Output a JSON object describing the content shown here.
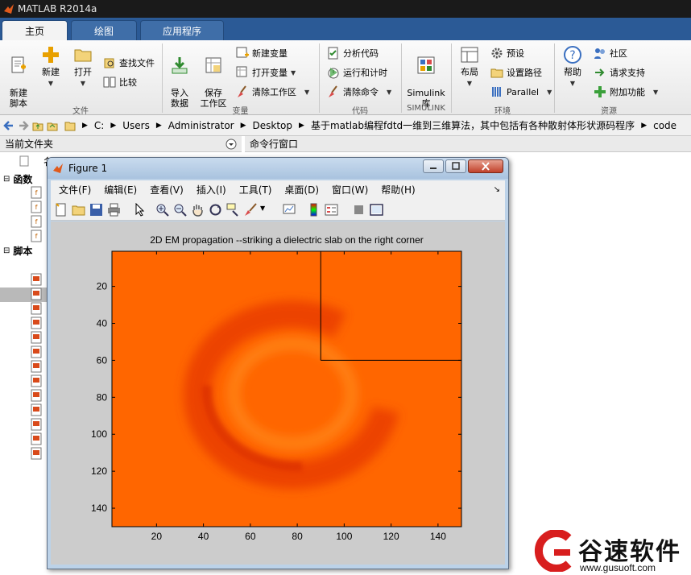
{
  "app": {
    "title": "MATLAB R2014a"
  },
  "tabs": [
    {
      "label": "主页"
    },
    {
      "label": "绘图"
    },
    {
      "label": "应用程序"
    }
  ],
  "ribbon": {
    "new_script": "新建\n脚本",
    "new": "新建",
    "open": "打开",
    "find_files": "查找文件",
    "compare": "比较",
    "import": "导入\n数据",
    "save_ws": "保存\n工作区",
    "new_var": "新建变量",
    "open_var": "打开变量",
    "clear_ws": "清除工作区",
    "analyze": "分析代码",
    "run_time": "运行和计时",
    "clear_cmd": "清除命令",
    "simulink": "Simulink\n库",
    "layout": "布局",
    "prefs": "预设",
    "set_path": "设置路径",
    "parallel": "Parallel",
    "help": "帮助",
    "community": "社区",
    "support": "请求支持",
    "addons": "附加功能",
    "groups": {
      "file": "文件",
      "variable": "变量",
      "code": "代码",
      "simulink": "SIMULINK",
      "env": "环境",
      "resources": "资源"
    }
  },
  "address": {
    "crumbs": [
      "C:",
      "Users",
      "Administrator",
      "Desktop",
      "基于matlab编程fdtd一维到三维算法，其中包括有各种散射体形状源码程序",
      "code"
    ]
  },
  "panels": {
    "current_folder": "当前文件夹",
    "command_window": "命令行窗口",
    "name_col": "名"
  },
  "tree": {
    "functions": "函数",
    "scripts": "脚本"
  },
  "figure": {
    "title": "Figure 1",
    "menu": [
      "文件(F)",
      "编辑(E)",
      "查看(V)",
      "插入(I)",
      "工具(T)",
      "桌面(D)",
      "窗口(W)",
      "帮助(H)"
    ]
  },
  "chart_data": {
    "type": "heatmap",
    "title": "2D EM propagation --striking a dielectric slab on the right corner",
    "xticks": [
      20,
      40,
      60,
      80,
      100,
      120,
      140
    ],
    "yticks": [
      20,
      40,
      60,
      80,
      100,
      120,
      140
    ],
    "xlim": [
      1,
      150
    ],
    "ylim": [
      1,
      150
    ],
    "y_reversed": true,
    "slab": {
      "x": [
        90,
        150
      ],
      "y": [
        1,
        60
      ]
    },
    "background_color": "#ff6600",
    "wave_color": "#e83a00"
  },
  "watermark": {
    "text": "谷速软件",
    "url": "www.gusuoft.com"
  }
}
